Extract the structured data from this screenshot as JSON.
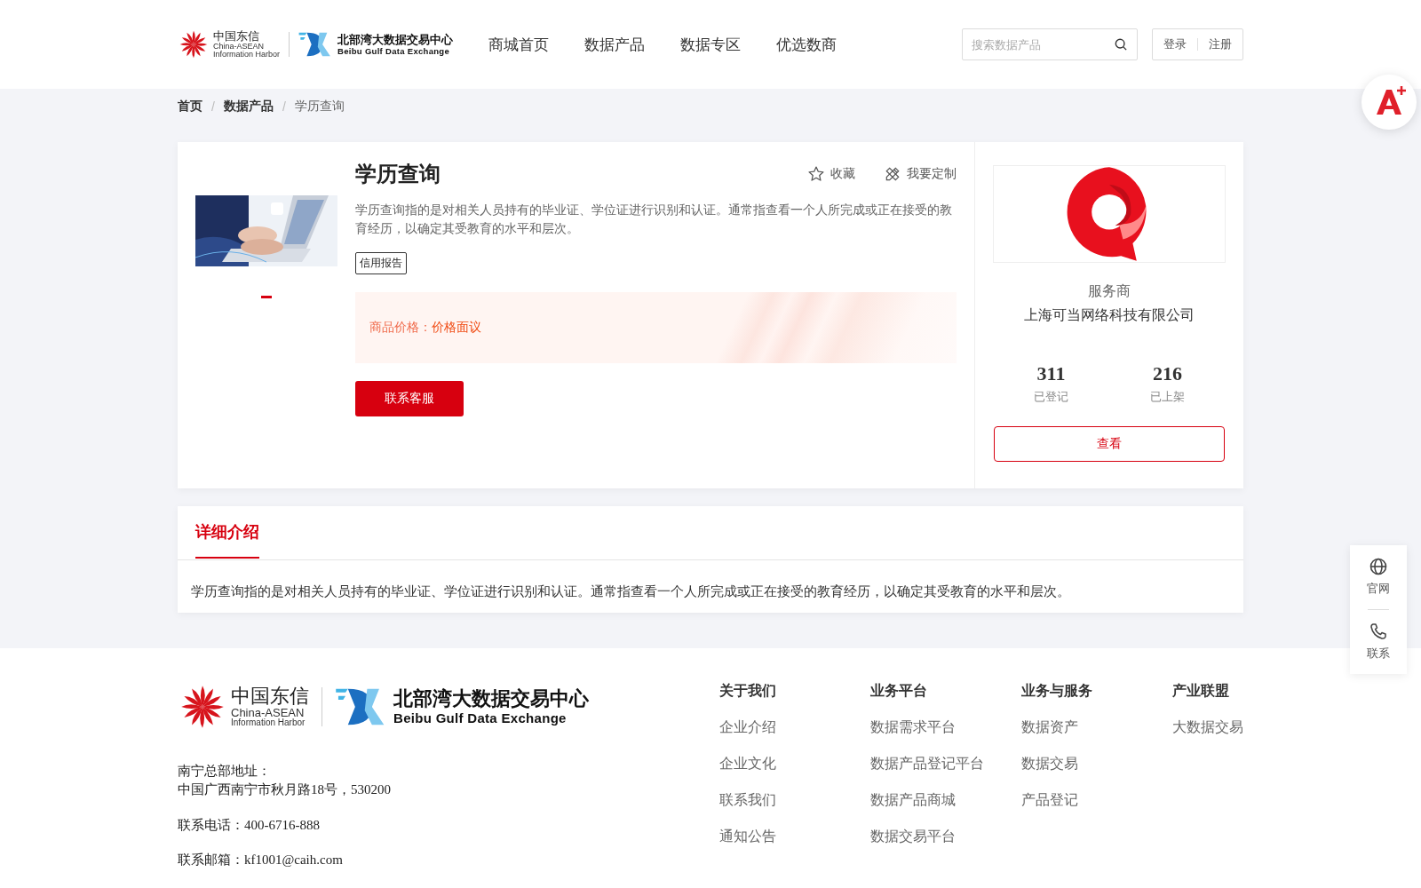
{
  "header": {
    "logo": {
      "cn": "中国东信",
      "en1": "China-ASEAN",
      "en2": "Information Harbor",
      "name_cn": "北部湾大数据交易中心",
      "name_en": "Beibu Gulf Data Exchange"
    },
    "nav": [
      {
        "label": "商城首页",
        "selected": false
      },
      {
        "label": "数据产品",
        "selected": false
      },
      {
        "label": "数据专区",
        "selected": false
      },
      {
        "label": "优选数商",
        "selected": false
      }
    ],
    "search": {
      "placeholder": "搜索数据产品"
    },
    "auth": [
      "登录",
      "注册"
    ]
  },
  "breadcrumb": {
    "separator": "/",
    "items": [
      {
        "label": "首页",
        "current": false
      },
      {
        "label": "数据产品",
        "current": false
      },
      {
        "label": "学历查询",
        "current": true
      }
    ]
  },
  "product": {
    "image": {
      "kind": "picture"
    },
    "title": "学历查询",
    "actions": [
      "收藏",
      "我要定制"
    ],
    "description": "学历查询指的是对相关人员持有的毕业证、学位证进行识别和认证。通常指查看一个人所完成或正在接受的教育经历，以确定其受教育的水平和层次。",
    "tags": [
      "信用报告"
    ],
    "price_label": "商品价格：",
    "price_value": "价格面议",
    "contact_button": "联系客服"
  },
  "provider": {
    "label": "服务商",
    "name": "上海可当网络科技有限公司",
    "stats": [
      {
        "value": "311",
        "label": "已登记"
      },
      {
        "value": "216",
        "label": "已上架"
      }
    ],
    "view_button": "查看"
  },
  "detail": {
    "tabs": [
      {
        "label": "详细介绍",
        "selected": true
      }
    ],
    "text": "学历查询指的是对相关人员持有的毕业证、学位证进行识别和认证。通常指查看一个人所完成或正在接受的教育经历，以确定其受教育的水平和层次。"
  },
  "side_panel": [
    {
      "kind": "globe",
      "label": "官网"
    },
    {
      "kind": "phone",
      "label": "联系"
    }
  ],
  "footer": {
    "logo": {
      "cn": "中国东信",
      "en1": "China-ASEAN",
      "en2": "Information Harbor",
      "name_cn": "北部湾大数据交易中心",
      "name_en": "Beibu Gulf Data Exchange"
    },
    "address_label": "南宁总部地址：",
    "address": "中国广西南宁市秋月路18号，530200",
    "phone": "联系电话：400-6716-888",
    "email": "联系邮箱：kf1001@caih.com",
    "columns": [
      {
        "title": "关于我们",
        "links": [
          "企业介绍",
          "企业文化",
          "联系我们",
          "通知公告"
        ]
      },
      {
        "title": "业务平台",
        "links": [
          "数据需求平台",
          "数据产品登记平台",
          "数据产品商城",
          "数据交易平台"
        ]
      },
      {
        "title": "业务与服务",
        "links": [
          "数据资产",
          "数据交易",
          "产品登记"
        ]
      },
      {
        "title": "产业联盟",
        "links": [
          "大数据交易"
        ]
      }
    ]
  }
}
